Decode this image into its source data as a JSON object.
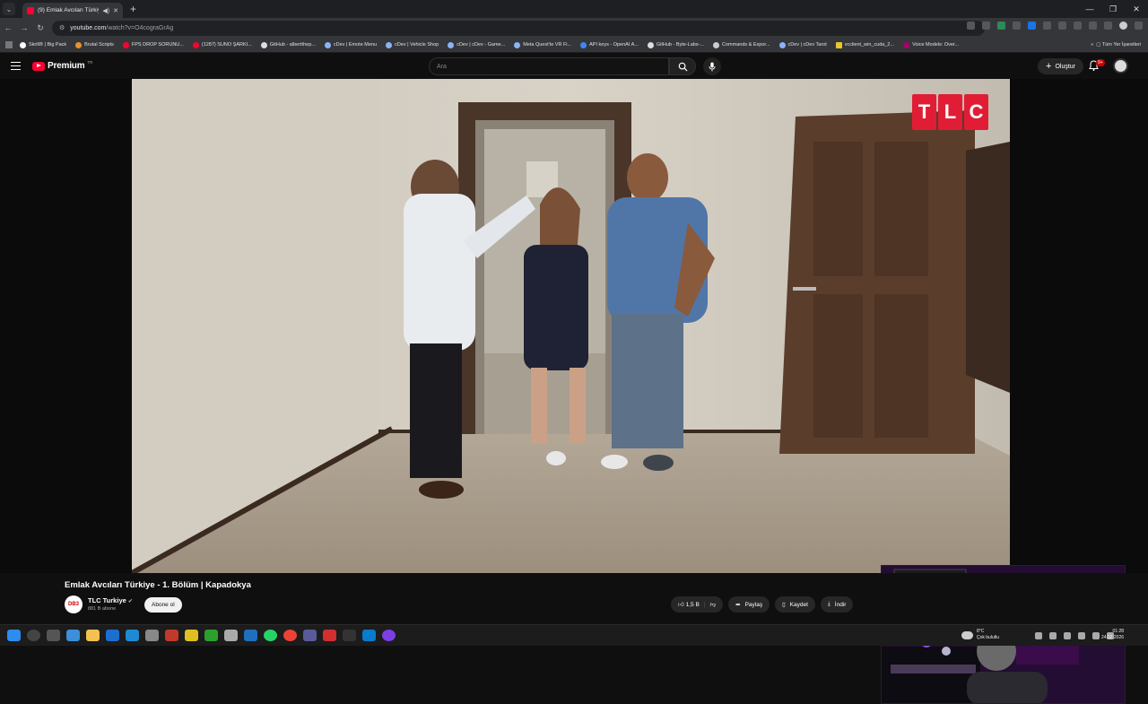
{
  "browser": {
    "tab_title": "(9) Emlak Avcıları Türkiye -",
    "url_host": "youtube.com",
    "url_path": "/watch?v=O4cograGrAg",
    "bookmarks": [
      "Skrill® | Big Pack",
      "Brutal Scripts",
      "FPS DROP SORUNU...",
      "(1287) SUNO ŞARKI...",
      "GitHub - albertthep...",
      "cDev | Emote Menu",
      "cDev | Vehicle Shop",
      "cDev | cDev - Game...",
      "Meta Quest'te VR Fi...",
      "API keys - OpenAI A...",
      "GitHub - Byte-Labs-...",
      "Commands & Expor...",
      "cDev | cDev Tarot",
      "vcclient_win_cuda_2...",
      "Voice Models: Over..."
    ],
    "bookmarks_right": "Tüm Yer İşaretleri"
  },
  "youtube": {
    "brand": "Premium",
    "region": "TR",
    "search_placeholder": "Ara",
    "create_label": "Oluştur",
    "notif_badge": "9+"
  },
  "player": {
    "channel_bug": [
      "T",
      "L",
      "C"
    ]
  },
  "video": {
    "title": "Emlak Avcıları Türkiye - 1. Bölüm | Kapadokya",
    "channel_avatar_text": "DB3",
    "channel_name": "TLC Turkiye",
    "verified": "✔",
    "subscribers": "881 B abone",
    "subscribe_label": "Abone ol",
    "likes": "1,5 B",
    "share_label": "Paylaş",
    "save_label": "Kaydet",
    "download_label": "İndir"
  },
  "taskbar": {
    "temp": "8°C",
    "weather": "Çok bulutlu",
    "time": "01:28",
    "date": "24.02.2026"
  }
}
